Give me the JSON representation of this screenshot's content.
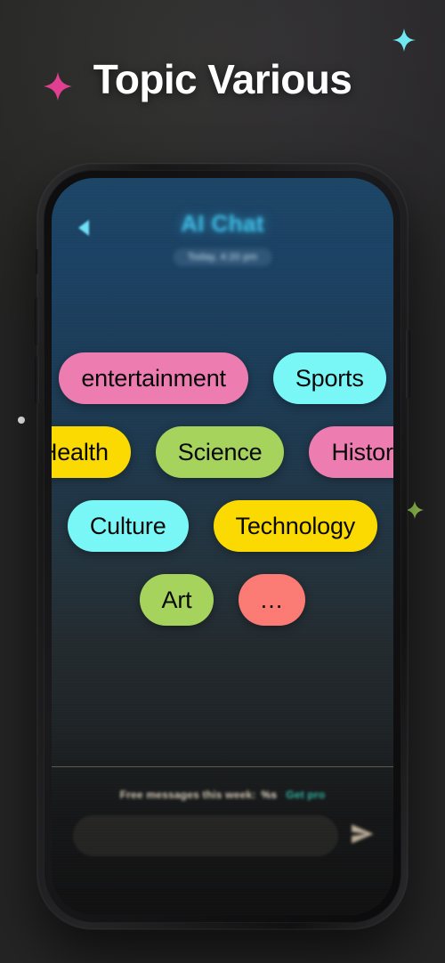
{
  "page": {
    "title": "Topic Various",
    "background_color": "#242424"
  },
  "decorations": {
    "star_pink": {
      "name": "sparkle-star-pink",
      "color": "#e0408f"
    },
    "star_cyan": {
      "name": "sparkle-star-cyan",
      "color": "#6fe8f0"
    },
    "diamond_green": {
      "name": "sparkle-diamond-green",
      "color": "#9fd356"
    },
    "dot_white": {
      "name": "dot-white",
      "color": "#f4f4f4"
    }
  },
  "phone": {
    "chat": {
      "back_label": "Back",
      "header_title": "AI Chat",
      "timestamp": "Today, 4:20 pm",
      "title_color": "#3fbfe8"
    },
    "topic_rows": [
      [
        {
          "label": "entertainment",
          "color": "#ed7cb0"
        },
        {
          "label": "Sports",
          "color": "#79f7f7"
        }
      ],
      [
        {
          "label": "Health",
          "color": "#fada00"
        },
        {
          "label": "Science",
          "color": "#a5d35c"
        },
        {
          "label": "History",
          "color": "#ed7cb0"
        }
      ],
      [
        {
          "label": "Culture",
          "color": "#79f7f7"
        },
        {
          "label": "Technology",
          "color": "#fada00"
        }
      ],
      [
        {
          "label": "Art",
          "color": "#a5d35c"
        },
        {
          "label": "…",
          "color": "#fb7b74"
        }
      ]
    ],
    "footer": {
      "free_messages_label": "Free messages this week:",
      "free_messages_count": "%s",
      "get_pro_label": "Get pro",
      "get_pro_color": "#2fb9a8",
      "input_placeholder": "",
      "input_value": "",
      "send_label": "Send"
    }
  }
}
